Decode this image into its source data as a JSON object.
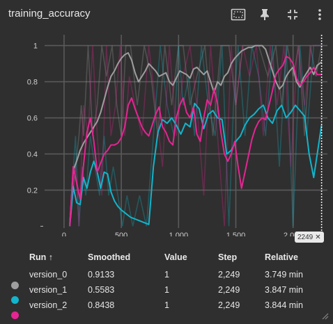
{
  "card": {
    "title": "training_accuracy"
  },
  "toolbar": {
    "buttons": [
      {
        "name": "fit-domain-button",
        "icon": "fit-to-data-icon"
      },
      {
        "name": "pin-button",
        "icon": "pin-icon"
      },
      {
        "name": "collapse-button",
        "icon": "collapse-icon"
      },
      {
        "name": "more-button",
        "icon": "more-vert-icon"
      }
    ]
  },
  "chart_data": {
    "type": "line",
    "xlim": [
      -170,
      2300
    ],
    "ylim": [
      -0.01,
      1.06
    ],
    "x_ticks": [
      0,
      500,
      1000,
      1500,
      2000
    ],
    "x_tick_labels": [
      "0",
      "500",
      "1,000",
      "1,500",
      "2,000"
    ],
    "y_ticks": [
      0.2,
      0.4,
      0.6,
      0.8,
      1
    ],
    "y_tick_labels": [
      "0.2",
      "0.4",
      "0.6",
      "0.8",
      "1"
    ],
    "grid": true,
    "hover_step": 2249,
    "hover_label": "2249",
    "series": [
      {
        "name": "version_0",
        "color": "#9e9e9e",
        "raw_x": [
          50,
          100,
          130,
          150,
          170,
          210,
          250,
          290,
          330,
          370,
          420,
          460,
          500,
          540,
          580,
          640,
          700,
          760,
          820,
          880,
          940,
          1000,
          1040,
          1100,
          1160,
          1230,
          1300,
          1370,
          1440,
          1500,
          1560,
          1620,
          1700,
          1780,
          1850,
          1900,
          1950,
          2000,
          2050,
          2100,
          2150,
          2200,
          2249
        ],
        "raw_y": [
          0,
          0.33,
          0.5,
          0.67,
          0.5,
          1,
          0.5,
          0.67,
          1,
          0.83,
          1,
          0.67,
          0.5,
          1,
          1,
          0.67,
          1,
          0.83,
          0.5,
          1,
          0.67,
          1,
          1,
          0.67,
          0.83,
          1,
          0.5,
          1,
          1,
          0.67,
          1,
          1,
          1,
          0.83,
          1,
          0.67,
          1,
          0.83,
          1,
          0.5,
          1,
          0.83,
          1
        ],
        "smooth_x": [
          50,
          80,
          110,
          140,
          170,
          200,
          230,
          260,
          290,
          320,
          350,
          380,
          410,
          440,
          470,
          500,
          530,
          560,
          590,
          620,
          650,
          680,
          710,
          740,
          770,
          800,
          830,
          860,
          890,
          920,
          950,
          980,
          1010,
          1040,
          1070,
          1100,
          1130,
          1160,
          1190,
          1220,
          1250,
          1280,
          1310,
          1340,
          1370,
          1400,
          1430,
          1460,
          1490,
          1520,
          1550,
          1580,
          1610,
          1640,
          1670,
          1700,
          1730,
          1760,
          1790,
          1820,
          1850,
          1880,
          1910,
          1940,
          1970,
          2000,
          2030,
          2060,
          2090,
          2120,
          2150,
          2180,
          2210,
          2249
        ],
        "smooth_y": [
          0.01,
          0.31,
          0.36,
          0.42,
          0.46,
          0.49,
          0.52,
          0.55,
          0.58,
          0.63,
          0.7,
          0.77,
          0.83,
          0.86,
          0.9,
          0.93,
          0.95,
          0.96,
          0.92,
          0.85,
          0.8,
          0.83,
          0.86,
          0.9,
          0.88,
          0.86,
          0.83,
          0.84,
          0.85,
          0.8,
          0.78,
          0.82,
          0.86,
          0.85,
          0.84,
          0.82,
          0.87,
          0.88,
          0.86,
          0.84,
          0.86,
          0.8,
          0.74,
          0.8,
          0.78,
          0.83,
          0.85,
          0.9,
          0.93,
          0.95,
          0.97,
          0.98,
          0.99,
          0.99,
          1,
          1,
          1,
          0.98,
          0.92,
          0.86,
          0.8,
          0.76,
          0.78,
          0.83,
          0.86,
          0.88,
          0.8,
          0.77,
          0.82,
          0.85,
          0.88,
          0.84,
          0.89,
          0.91
        ]
      },
      {
        "name": "version_1",
        "color": "#12b5cb",
        "raw_x": [
          50,
          100,
          130,
          160,
          190,
          230,
          270,
          310,
          350,
          390,
          430,
          470,
          510,
          550,
          600,
          660,
          720,
          780,
          840,
          900,
          960,
          1000,
          1040,
          1090,
          1140,
          1200,
          1260,
          1320,
          1380,
          1440,
          1480,
          1520,
          1580,
          1640,
          1700,
          1760,
          1820,
          1880,
          1940,
          2000,
          2060,
          2120,
          2180,
          2249
        ],
        "raw_y": [
          0,
          0.5,
          0,
          0.33,
          0.17,
          0.5,
          0.33,
          0.17,
          0.5,
          0.17,
          0.33,
          0.17,
          0,
          0.17,
          0,
          0.17,
          0,
          0.5,
          1,
          0.67,
          0.5,
          1,
          0.67,
          0.83,
          0.5,
          1,
          0.67,
          0.5,
          1,
          0,
          0.67,
          1,
          0.5,
          1,
          0.83,
          0.5,
          1,
          0.33,
          1,
          0,
          1,
          0.5,
          1,
          1
        ],
        "smooth_x": [
          50,
          80,
          110,
          140,
          170,
          200,
          230,
          260,
          290,
          320,
          350,
          380,
          410,
          440,
          470,
          500,
          540,
          580,
          620,
          660,
          700,
          740,
          780,
          820,
          860,
          900,
          940,
          980,
          1020,
          1060,
          1100,
          1140,
          1180,
          1220,
          1260,
          1300,
          1340,
          1380,
          1420,
          1460,
          1500,
          1540,
          1580,
          1620,
          1660,
          1700,
          1740,
          1780,
          1820,
          1860,
          1900,
          1940,
          1980,
          2020,
          2060,
          2100,
          2140,
          2180,
          2249
        ],
        "smooth_y": [
          0,
          0.22,
          0.13,
          0.12,
          0.27,
          0.21,
          0.3,
          0.36,
          0.3,
          0.21,
          0.3,
          0.29,
          0.19,
          0.14,
          0.11,
          0.09,
          0.07,
          0.05,
          0.04,
          0.03,
          0.02,
          0.01,
          0.33,
          0.52,
          0.59,
          0.57,
          0.6,
          0.56,
          0.51,
          0.57,
          0.55,
          0.68,
          0.65,
          0.54,
          0.62,
          0.64,
          0.6,
          0.59,
          0.4,
          0.42,
          0.47,
          0.5,
          0.56,
          0.6,
          0.62,
          0.65,
          0.67,
          0.6,
          0.57,
          0.64,
          0.67,
          0.6,
          0.63,
          0.67,
          0.64,
          0.61,
          0.4,
          0.27,
          0.56
        ]
      },
      {
        "name": "version_2",
        "color": "#e52592",
        "raw_x": [
          50,
          100,
          130,
          170,
          210,
          250,
          290,
          330,
          370,
          410,
          450,
          490,
          530,
          570,
          620,
          680,
          740,
          800,
          860,
          920,
          980,
          1040,
          1100,
          1160,
          1220,
          1280,
          1340,
          1400,
          1460,
          1500,
          1560,
          1620,
          1680,
          1740,
          1800,
          1860,
          1920,
          1980,
          2040,
          2100,
          2160,
          2249
        ],
        "raw_y": [
          0,
          0.33,
          0,
          0.67,
          0.5,
          1,
          0.5,
          0.17,
          1,
          0.5,
          0.67,
          1,
          0.5,
          0.83,
          0.67,
          0.5,
          1,
          0.67,
          0.33,
          1,
          0.5,
          0.83,
          1,
          0.67,
          0.17,
          1,
          0.5,
          0,
          1,
          0.67,
          1,
          0.83,
          1,
          0.5,
          1,
          0.67,
          1,
          0.33,
          1,
          0.67,
          1,
          1
        ],
        "smooth_x": [
          50,
          80,
          110,
          140,
          170,
          200,
          230,
          260,
          290,
          320,
          350,
          380,
          410,
          440,
          470,
          500,
          530,
          560,
          590,
          620,
          650,
          680,
          710,
          740,
          770,
          800,
          830,
          860,
          890,
          920,
          950,
          980,
          1010,
          1040,
          1070,
          1100,
          1130,
          1160,
          1190,
          1220,
          1250,
          1280,
          1310,
          1340,
          1370,
          1400,
          1430,
          1460,
          1490,
          1520,
          1550,
          1580,
          1610,
          1640,
          1670,
          1700,
          1730,
          1760,
          1790,
          1820,
          1850,
          1880,
          1910,
          1940,
          1970,
          2000,
          2030,
          2060,
          2090,
          2120,
          2150,
          2180,
          2210,
          2249
        ],
        "smooth_y": [
          0,
          0.33,
          0.24,
          0.15,
          0.34,
          0.52,
          0.6,
          0.47,
          0.3,
          0.35,
          0.4,
          0.42,
          0.45,
          0.45,
          0.46,
          0.49,
          0.55,
          0.67,
          0.71,
          0.65,
          0.6,
          0.55,
          0.52,
          0.5,
          0.56,
          0.62,
          0.66,
          0.55,
          0.52,
          0.47,
          0.45,
          0.6,
          0.67,
          0.71,
          0.63,
          0.6,
          0.66,
          0.51,
          0.47,
          0.6,
          0.7,
          0.67,
          0.76,
          0.68,
          0.52,
          0.4,
          0.36,
          0.4,
          0.47,
          0.33,
          0.21,
          0.3,
          0.39,
          0.48,
          0.54,
          0.58,
          0.6,
          0.59,
          0.67,
          0.75,
          0.84,
          0.87,
          0.89,
          0.94,
          0.93,
          0.9,
          0.82,
          0.78,
          0.8,
          0.83,
          0.85,
          0.88,
          0.84,
          0.84
        ]
      }
    ]
  },
  "hover_badge": {
    "label": "2249",
    "close_icon": "close-icon"
  },
  "table": {
    "headers": {
      "run": "Run ↑",
      "smoothed": "Smoothed",
      "value": "Value",
      "step": "Step",
      "relative": "Relative"
    },
    "rows": [
      {
        "color": "#9e9e9e",
        "run": "version_0",
        "smoothed": "0.9133",
        "value": "1",
        "step": "2,249",
        "relative": "3.749 min"
      },
      {
        "color": "#12b5cb",
        "run": "version_1",
        "smoothed": "0.5583",
        "value": "1",
        "step": "2,249",
        "relative": "3.847 min"
      },
      {
        "color": "#e52592",
        "run": "version_2",
        "smoothed": "0.8438",
        "value": "1",
        "step": "2,249",
        "relative": "3.844 min"
      }
    ]
  }
}
